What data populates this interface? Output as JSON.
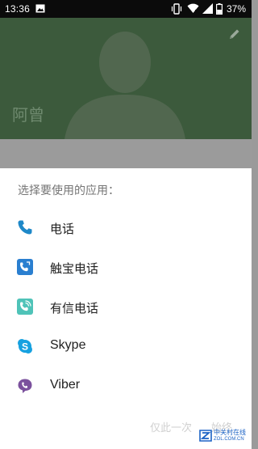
{
  "status_bar": {
    "time": "13:36",
    "battery_text": "37%",
    "icons": [
      "gallery-icon",
      "vibrate-icon",
      "wifi-icon",
      "signal-icon",
      "battery-icon"
    ]
  },
  "contact": {
    "name": "阿曾",
    "header_color": "#3c5a3c",
    "edit_icon": "pencil-icon"
  },
  "chooser": {
    "title": "选择要使用的应用：",
    "apps": [
      {
        "label": "电话",
        "icon": "phone-icon",
        "color": "#1e88c8"
      },
      {
        "label": "触宝电话",
        "icon": "touchpal-icon",
        "color": "#2a7fd0"
      },
      {
        "label": "有信电话",
        "icon": "uxin-icon",
        "color": "#4fc3b8"
      },
      {
        "label": "Skype",
        "icon": "skype-icon",
        "color": "#16a1e0"
      },
      {
        "label": "Viber",
        "icon": "viber-icon",
        "color": "#7b519d"
      }
    ],
    "just_once_label": "仅此一次",
    "always_label": "始终"
  },
  "watermark": {
    "text_cn": "中关村在线",
    "text_url": "ZOL.COM.CN"
  }
}
